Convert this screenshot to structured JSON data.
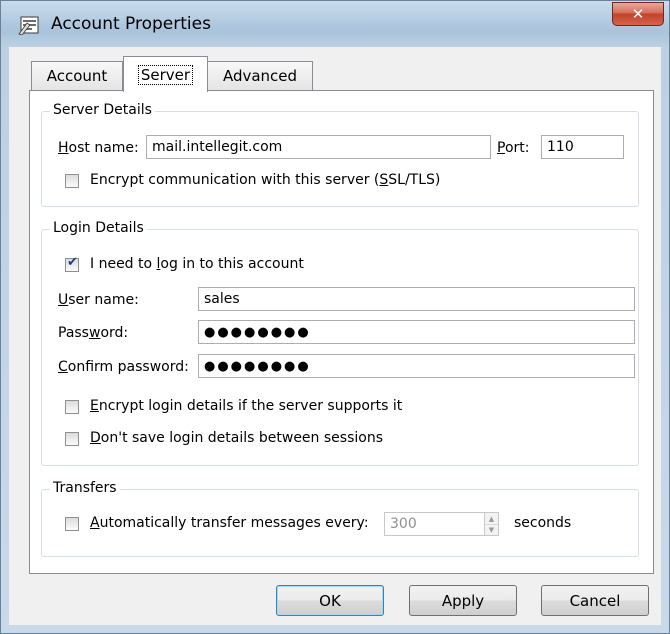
{
  "window": {
    "title": "Account Properties",
    "close_glyph": "✕"
  },
  "tabs": [
    {
      "label": "Account",
      "active": false
    },
    {
      "label": "Server",
      "active": true
    },
    {
      "label": "Advanced",
      "active": false
    }
  ],
  "server_details": {
    "title": "Server Details",
    "host_label_u": "H",
    "host_label_rest": "ost name:",
    "host_value": "mail.intellegit.com",
    "port_label_u": "P",
    "port_label_rest": "ort:",
    "port_value": "110",
    "encrypt_label_a": "Encrypt communication with this server (",
    "encrypt_label_u": "S",
    "encrypt_label_b": "SL/TLS)",
    "encrypt_checked": false
  },
  "login_details": {
    "title": "Login Details",
    "need_login_a": "I need to ",
    "need_login_u": "l",
    "need_login_b": "og in to this account",
    "need_login_checked": true,
    "username_label_u": "U",
    "username_label_rest": "ser name:",
    "username_value": "sales",
    "password_label_a": "Pass",
    "password_label_u": "w",
    "password_label_b": "ord:",
    "password_value": "●●●●●●●●",
    "confirm_label_u": "C",
    "confirm_label_rest": "onfirm password:",
    "confirm_value": "●●●●●●●●",
    "encrypt_login_u": "E",
    "encrypt_login_rest": "ncrypt login details if the server supports it",
    "encrypt_login_checked": false,
    "dont_save_u": "D",
    "dont_save_rest": "on't save login details between sessions",
    "dont_save_checked": false
  },
  "transfers": {
    "title": "Transfers",
    "auto_u": "A",
    "auto_rest": "utomatically transfer messages every:",
    "auto_checked": false,
    "interval_value": "300",
    "seconds_label": "seconds"
  },
  "buttons": {
    "ok": "OK",
    "apply": "Apply",
    "cancel": "Cancel"
  },
  "icons": {
    "app": "account-properties-icon",
    "spin_up": "▲",
    "spin_down": "▼"
  }
}
